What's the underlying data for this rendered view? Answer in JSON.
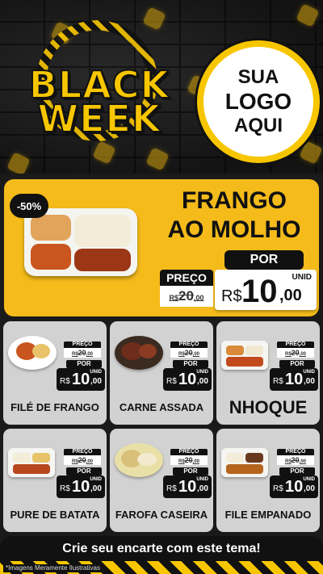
{
  "header": {
    "headline_line1": "BLACK",
    "headline_line2": "WEEK",
    "logo_line1": "SUA",
    "logo_line2": "LOGO",
    "logo_line3": "AQUI"
  },
  "featured": {
    "discount_badge": "-50%",
    "name_line1": "FRANGO",
    "name_line2": "AO MOLHO",
    "preco_label": "PREÇO",
    "old_currency": "R$",
    "old_int": "20",
    "old_dec": ",00",
    "por_label": "POR",
    "unit_label": "UNID",
    "currency": "R$",
    "price_int": "10",
    "price_dec": ",00"
  },
  "products": [
    {
      "name": "FILÉ DE FRANGO",
      "preco_label": "PREÇO",
      "old_currency": "R$",
      "old_int": "20",
      "old_dec": ",00",
      "por_label": "POR",
      "unit_label": "UNID",
      "currency": "R$",
      "price_int": "10",
      "price_dec": ",00"
    },
    {
      "name": "CARNE ASSADA",
      "preco_label": "PREÇO",
      "old_currency": "R$",
      "old_int": "20",
      "old_dec": ",00",
      "por_label": "POR",
      "unit_label": "UNID",
      "currency": "R$",
      "price_int": "10",
      "price_dec": ",00"
    },
    {
      "name": "NHOQUE",
      "preco_label": "PREÇO",
      "old_currency": "R$",
      "old_int": "20",
      "old_dec": ",00",
      "por_label": "POR",
      "unit_label": "UNID",
      "currency": "R$",
      "price_int": "10",
      "price_dec": ",00"
    },
    {
      "name": "PURE DE BATATA",
      "preco_label": "PREÇO",
      "old_currency": "R$",
      "old_int": "20",
      "old_dec": ",00",
      "por_label": "POR",
      "unit_label": "UNID",
      "currency": "R$",
      "price_int": "10",
      "price_dec": ",00"
    },
    {
      "name": "FAROFA CASEIRA",
      "preco_label": "PREÇO",
      "old_currency": "R$",
      "old_int": "20",
      "old_dec": ",00",
      "por_label": "POR",
      "unit_label": "UNID",
      "currency": "R$",
      "price_int": "10",
      "price_dec": ",00"
    },
    {
      "name": "FILE EMPANADO",
      "preco_label": "PREÇO",
      "old_currency": "R$",
      "old_int": "20",
      "old_dec": ",00",
      "por_label": "POR",
      "unit_label": "UNID",
      "currency": "R$",
      "price_int": "10",
      "price_dec": ",00"
    }
  ],
  "footer": {
    "cta_label": "Crie seu encarte com este tema!",
    "disclaimer": "*Imagens Meramente Ilustrativas"
  },
  "colors": {
    "accent_yellow": "#f5bb1b",
    "dark": "#111111",
    "card_gray": "#d2d2d2"
  }
}
